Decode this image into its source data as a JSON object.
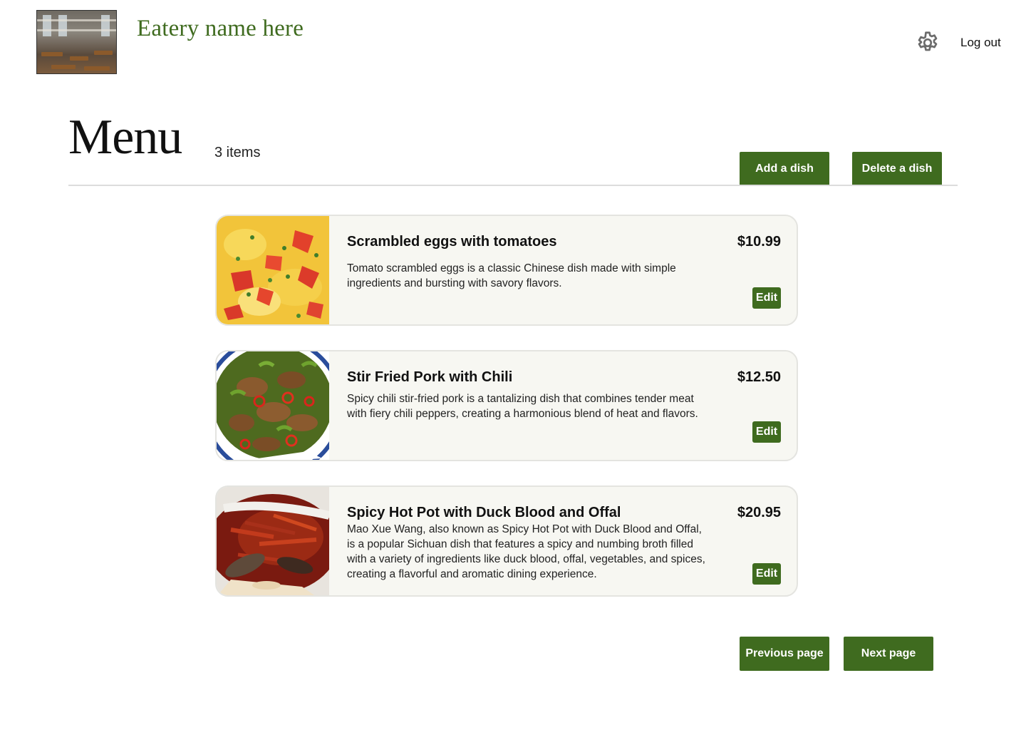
{
  "header": {
    "eatery_name": "Eatery name here",
    "logout_label": "Log out",
    "logo_icon": "restaurant-photo",
    "settings_icon": "gear-icon"
  },
  "menu": {
    "title": "Menu",
    "item_count": "3 items",
    "add_label": "Add a dish",
    "delete_label": "Delete a dish"
  },
  "dishes": [
    {
      "name": "Scrambled eggs with tomatoes",
      "price": "$10.99",
      "description": "Tomato scrambled eggs is a classic Chinese dish made with simple ingredients and bursting with savory flavors.",
      "edit_label": "Edit",
      "image_icon": "scrambled-eggs-photo"
    },
    {
      "name": "Stir Fried Pork with Chili",
      "price": "$12.50",
      "description": "Spicy chili stir-fried pork is a tantalizing dish that combines tender meat with fiery chili peppers, creating a harmonious blend of heat and flavors.",
      "edit_label": "Edit",
      "image_icon": "stir-fried-pork-photo"
    },
    {
      "name": "Spicy Hot Pot with Duck Blood and Offal",
      "price": "$20.95",
      "description": "Mao Xue Wang, also known as Spicy Hot Pot with Duck Blood and Offal, is a popular Sichuan dish that features a spicy and numbing broth filled with a variety of ingredients like duck blood, offal, vegetables, and spices, creating a flavorful and aromatic dining experience.",
      "edit_label": "Edit",
      "image_icon": "hot-pot-photo"
    }
  ],
  "pagination": {
    "previous_label": "Previous page",
    "next_label": "Next page"
  },
  "colors": {
    "accent": "#3f6b1f",
    "card_background": "#f7f7f2",
    "card_border": "#e4e4e0"
  }
}
